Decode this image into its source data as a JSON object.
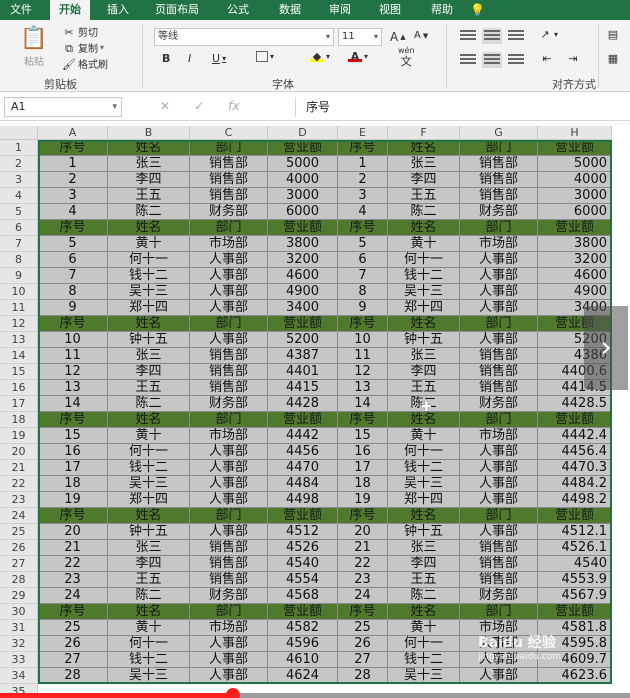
{
  "ribbon": {
    "tabs": [
      "文件",
      "开始",
      "插入",
      "页面布局",
      "公式",
      "数据",
      "审阅",
      "视图",
      "帮助"
    ],
    "active_tab": "开始",
    "clipboard": {
      "paste": "粘贴",
      "cut": "剪切",
      "copy": "复制",
      "format_painter": "格式刷",
      "label": "剪贴板"
    },
    "font": {
      "name": "等线",
      "size": "11",
      "grow": "A",
      "shrink": "A",
      "bold": "B",
      "italic": "I",
      "underline": "U",
      "wen": "wén",
      "wen_char": "文",
      "label": "字体"
    },
    "alignment": {
      "label": "对齐方式"
    }
  },
  "formula_bar": {
    "name_box": "A1",
    "formula": "序号"
  },
  "sheet": {
    "columns": [
      "A",
      "B",
      "C",
      "D",
      "E",
      "F",
      "G",
      "H"
    ],
    "row_numbers": [
      "1",
      "2",
      "3",
      "4",
      "5",
      "6",
      "7",
      "8",
      "9",
      "10",
      "11",
      "12",
      "13",
      "14",
      "15",
      "16",
      "17",
      "18",
      "19",
      "20",
      "21",
      "22",
      "23",
      "24",
      "25",
      "26",
      "27",
      "28",
      "29",
      "30",
      "31",
      "32",
      "33",
      "34",
      "35"
    ],
    "rows": [
      [
        "序号",
        "姓名",
        "部门",
        "营业额",
        "序号",
        "姓名",
        "部门",
        "营业额"
      ],
      [
        "1",
        "张三",
        "销售部",
        "5000",
        "1",
        "张三",
        "销售部",
        "5000"
      ],
      [
        "2",
        "李四",
        "销售部",
        "4000",
        "2",
        "李四",
        "销售部",
        "4000"
      ],
      [
        "3",
        "王五",
        "销售部",
        "3000",
        "3",
        "王五",
        "销售部",
        "3000"
      ],
      [
        "4",
        "陈二",
        "财务部",
        "6000",
        "4",
        "陈二",
        "财务部",
        "6000"
      ],
      [
        "序号",
        "姓名",
        "部门",
        "营业额",
        "序号",
        "姓名",
        "部门",
        "营业额"
      ],
      [
        "5",
        "黄十",
        "市场部",
        "3800",
        "5",
        "黄十",
        "市场部",
        "3800"
      ],
      [
        "6",
        "何十一",
        "人事部",
        "3200",
        "6",
        "何十一",
        "人事部",
        "3200"
      ],
      [
        "7",
        "钱十二",
        "人事部",
        "4600",
        "7",
        "钱十二",
        "人事部",
        "4600"
      ],
      [
        "8",
        "吴十三",
        "人事部",
        "4900",
        "8",
        "吴十三",
        "人事部",
        "4900"
      ],
      [
        "9",
        "郑十四",
        "人事部",
        "3400",
        "9",
        "郑十四",
        "人事部",
        "3400"
      ],
      [
        "序号",
        "姓名",
        "部门",
        "营业额",
        "序号",
        "姓名",
        "部门",
        "营业额"
      ],
      [
        "10",
        "钟十五",
        "人事部",
        "5200",
        "10",
        "钟十五",
        "人事部",
        "5200"
      ],
      [
        "11",
        "张三",
        "销售部",
        "4387",
        "11",
        "张三",
        "销售部",
        "4386"
      ],
      [
        "12",
        "李四",
        "销售部",
        "4401",
        "12",
        "李四",
        "销售部",
        "4400.6"
      ],
      [
        "13",
        "王五",
        "销售部",
        "4415",
        "13",
        "王五",
        "销售部",
        "4414.5"
      ],
      [
        "14",
        "陈二",
        "财务部",
        "4428",
        "14",
        "陈二",
        "财务部",
        "4428.5"
      ],
      [
        "序号",
        "姓名",
        "部门",
        "营业额",
        "序号",
        "姓名",
        "部门",
        "营业额"
      ],
      [
        "15",
        "黄十",
        "市场部",
        "4442",
        "15",
        "黄十",
        "市场部",
        "4442.4"
      ],
      [
        "16",
        "何十一",
        "人事部",
        "4456",
        "16",
        "何十一",
        "人事部",
        "4456.4"
      ],
      [
        "17",
        "钱十二",
        "人事部",
        "4470",
        "17",
        "钱十二",
        "人事部",
        "4470.3"
      ],
      [
        "18",
        "吴十三",
        "人事部",
        "4484",
        "18",
        "吴十三",
        "人事部",
        "4484.2"
      ],
      [
        "19",
        "郑十四",
        "人事部",
        "4498",
        "19",
        "郑十四",
        "人事部",
        "4498.2"
      ],
      [
        "序号",
        "姓名",
        "部门",
        "营业额",
        "序号",
        "姓名",
        "部门",
        "营业额"
      ],
      [
        "20",
        "钟十五",
        "人事部",
        "4512",
        "20",
        "钟十五",
        "人事部",
        "4512.1"
      ],
      [
        "21",
        "张三",
        "销售部",
        "4526",
        "21",
        "张三",
        "销售部",
        "4526.1"
      ],
      [
        "22",
        "李四",
        "销售部",
        "4540",
        "22",
        "李四",
        "销售部",
        "4540"
      ],
      [
        "23",
        "王五",
        "销售部",
        "4554",
        "23",
        "王五",
        "销售部",
        "4553.9"
      ],
      [
        "24",
        "陈二",
        "财务部",
        "4568",
        "24",
        "陈二",
        "财务部",
        "4567.9"
      ],
      [
        "序号",
        "姓名",
        "部门",
        "营业额",
        "序号",
        "姓名",
        "部门",
        "营业额"
      ],
      [
        "25",
        "黄十",
        "市场部",
        "4582",
        "25",
        "黄十",
        "市场部",
        "4581.8"
      ],
      [
        "26",
        "何十一",
        "人事部",
        "4596",
        "26",
        "何十一",
        "人事部",
        "4595.8"
      ],
      [
        "27",
        "钱十二",
        "人事部",
        "4610",
        "27",
        "钱十二",
        "人事部",
        "4609.7"
      ],
      [
        "28",
        "吴十三",
        "人事部",
        "4624",
        "28",
        "吴十三",
        "人事部",
        "4623.6"
      ]
    ]
  },
  "overlay": {
    "next_arrow": "›",
    "cursor": "✚",
    "video_progress": 0.37,
    "watermark": "Baidu 经验",
    "watermark_sub": "jingyan.baidu.com"
  },
  "colors": {
    "excel_green": "#217346",
    "header_fill": "#4f7a2e",
    "data_fill": "#c6c6c6",
    "progress": "#ff1f1f"
  },
  "icons": [
    "paste-icon",
    "cut-icon",
    "copy-icon",
    "format-painter-icon",
    "border-icon",
    "fill-color-icon",
    "font-color-icon",
    "align-icon",
    "lightbulb-icon"
  ]
}
